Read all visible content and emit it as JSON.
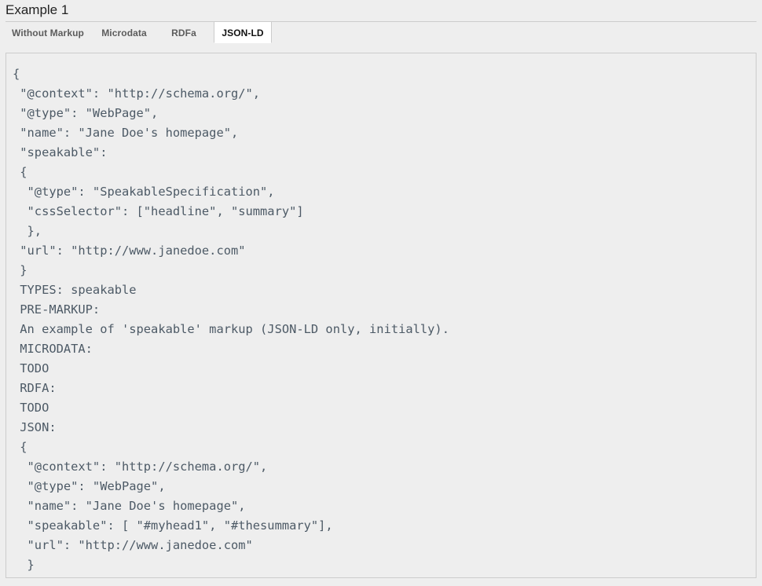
{
  "page": {
    "title": "Example 1",
    "background_color": "#eeeeee",
    "panel_border_color": "#cccccc",
    "code_text_color": "#4d5a66"
  },
  "tabs": {
    "items": [
      {
        "label": "Without Markup",
        "active": false
      },
      {
        "label": "Microdata",
        "active": false
      },
      {
        "label": "RDFa",
        "active": false
      },
      {
        "label": "JSON-LD",
        "active": true
      }
    ],
    "selected": "JSON-LD"
  },
  "code_panel": {
    "language": "json-ld",
    "content": "{\n \"@context\": \"http://schema.org/\",\n \"@type\": \"WebPage\",\n \"name\": \"Jane Doe's homepage\",\n \"speakable\":\n {\n  \"@type\": \"SpeakableSpecification\",\n  \"cssSelector\": [\"headline\", \"summary\"]\n  },\n \"url\": \"http://www.janedoe.com\"\n }\n TYPES: speakable\n PRE-MARKUP:\n An example of 'speakable' markup (JSON-LD only, initially).\n MICRODATA:\n TODO\n RDFA:\n TODO\n JSON:\n {\n  \"@context\": \"http://schema.org/\",\n  \"@type\": \"WebPage\",\n  \"name\": \"Jane Doe's homepage\",\n  \"speakable\": [ \"#myhead1\", \"#thesummary\"],\n  \"url\": \"http://www.janedoe.com\"\n  }",
    "lines": [
      "{",
      " \"@context\": \"http://schema.org/\",",
      " \"@type\": \"WebPage\",",
      " \"name\": \"Jane Doe's homepage\",",
      " \"speakable\":",
      " {",
      "  \"@type\": \"SpeakableSpecification\",",
      "  \"cssSelector\": [\"headline\", \"summary\"]",
      "  },",
      " \"url\": \"http://www.janedoe.com\"",
      " }",
      " TYPES: speakable",
      " PRE-MARKUP:",
      " An example of 'speakable' markup (JSON-LD only, initially).",
      " MICRODATA:",
      " TODO",
      " RDFA:",
      " TODO",
      " JSON:",
      " {",
      "  \"@context\": \"http://schema.org/\",",
      "  \"@type\": \"WebPage\",",
      "  \"name\": \"Jane Doe's homepage\",",
      "  \"speakable\": [ \"#myhead1\", \"#thesummary\"],",
      "  \"url\": \"http://www.janedoe.com\"",
      "  }"
    ]
  }
}
